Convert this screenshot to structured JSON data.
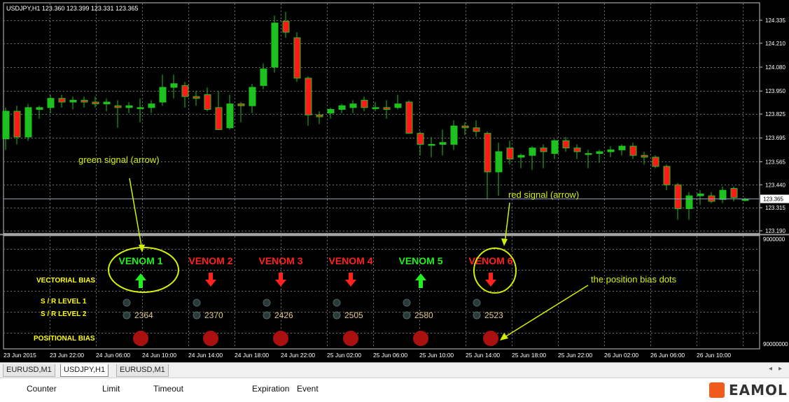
{
  "chart": {
    "symbol_info": "USDJPY,H1  123.360 123.399 123.331 123.365",
    "current_price": "123.365",
    "price_labels": [
      "124.335",
      "124.210",
      "124.080",
      "123.950",
      "123.825",
      "123.695",
      "123.565",
      "123.440",
      "123.315",
      "123.190"
    ],
    "indicator_labels": [
      "9000000",
      "90000000"
    ],
    "time_labels": [
      "23 Jun 2015",
      "23 Jun 22:00",
      "24 Jun 06:00",
      "24 Jun 10:00",
      "24 Jun 14:00",
      "24 Jun 18:00",
      "24 Jun 22:00",
      "25 Jun 02:00",
      "25 Jun 06:00",
      "25 Jun 10:00",
      "25 Jun 14:00",
      "25 Jun 18:00",
      "25 Jun 22:00",
      "26 Jun 02:00",
      "26 Jun 06:00",
      "26 Jun 10:00"
    ],
    "colors": {
      "bull": "#1ec21e",
      "bear": "#ff1a1a",
      "wick": "#1ec21e",
      "grid": "#707070",
      "annotation": "#d4f000",
      "venom_red": "#ff2020",
      "venom_green": "#22ee22",
      "row_label": "#ffff00",
      "dot": "#aa1010"
    }
  },
  "annotations": {
    "green_signal": "green signal (arrow)",
    "red_signal": "red signal (arrow)",
    "position_dots": "the position bias dots"
  },
  "panel": {
    "rows": [
      "VECTORIAL BIAS",
      "S / R LEVEL 1",
      "S / R LEVEL 2",
      "POSITIONAL BIAS"
    ],
    "venoms": [
      {
        "label": "VENOM 1",
        "direction": "up",
        "level2": "2364"
      },
      {
        "label": "VENOM 2",
        "direction": "down",
        "level2": "2370"
      },
      {
        "label": "VENOM 3",
        "direction": "down",
        "level2": "2426"
      },
      {
        "label": "VENOM 4",
        "direction": "down",
        "level2": "2505"
      },
      {
        "label": "VENOM 5",
        "direction": "up",
        "level2": "2580"
      },
      {
        "label": "VENOM 6",
        "direction": "down",
        "level2": "2523"
      }
    ]
  },
  "tabs": [
    "EURUSD,M1",
    "USDJPY,H1",
    "EURUSD,M1"
  ],
  "active_tab": 1,
  "terminal_columns": [
    "Counter",
    "Limit",
    "Timeout",
    "Expiration",
    "Event"
  ],
  "logo": "EAMOL",
  "candles": [
    {
      "o": 123.69,
      "h": 123.86,
      "l": 123.63,
      "c": 123.84
    },
    {
      "o": 123.84,
      "h": 123.87,
      "l": 123.66,
      "c": 123.7
    },
    {
      "o": 123.7,
      "h": 123.88,
      "l": 123.68,
      "c": 123.86
    },
    {
      "o": 123.85,
      "h": 123.87,
      "l": 123.8,
      "c": 123.86
    },
    {
      "o": 123.86,
      "h": 123.93,
      "l": 123.83,
      "c": 123.91
    },
    {
      "o": 123.91,
      "h": 123.93,
      "l": 123.86,
      "c": 123.89
    },
    {
      "o": 123.89,
      "h": 123.92,
      "l": 123.85,
      "c": 123.9
    },
    {
      "o": 123.9,
      "h": 123.92,
      "l": 123.86,
      "c": 123.89
    },
    {
      "o": 123.89,
      "h": 123.92,
      "l": 123.86,
      "c": 123.88
    },
    {
      "o": 123.88,
      "h": 123.91,
      "l": 123.84,
      "c": 123.89
    },
    {
      "o": 123.87,
      "h": 123.9,
      "l": 123.75,
      "c": 123.86
    },
    {
      "o": 123.86,
      "h": 123.89,
      "l": 123.83,
      "c": 123.87
    },
    {
      "o": 123.86,
      "h": 123.91,
      "l": 123.78,
      "c": 123.86
    },
    {
      "o": 123.86,
      "h": 123.9,
      "l": 123.83,
      "c": 123.88
    },
    {
      "o": 123.89,
      "h": 124.04,
      "l": 123.87,
      "c": 123.97
    },
    {
      "o": 123.97,
      "h": 124.04,
      "l": 123.91,
      "c": 123.99
    },
    {
      "o": 123.98,
      "h": 124.0,
      "l": 123.86,
      "c": 123.92
    },
    {
      "o": 123.92,
      "h": 123.95,
      "l": 123.87,
      "c": 123.91
    },
    {
      "o": 123.93,
      "h": 123.97,
      "l": 123.84,
      "c": 123.85
    },
    {
      "o": 123.86,
      "h": 123.95,
      "l": 123.77,
      "c": 123.74
    },
    {
      "o": 123.75,
      "h": 123.93,
      "l": 123.74,
      "c": 123.88
    },
    {
      "o": 123.88,
      "h": 123.89,
      "l": 123.78,
      "c": 123.87
    },
    {
      "o": 123.87,
      "h": 123.99,
      "l": 123.83,
      "c": 123.97
    },
    {
      "o": 123.98,
      "h": 124.1,
      "l": 123.96,
      "c": 124.07
    },
    {
      "o": 124.08,
      "h": 124.36,
      "l": 124.05,
      "c": 124.32
    },
    {
      "o": 124.33,
      "h": 124.38,
      "l": 124.24,
      "c": 124.27
    },
    {
      "o": 124.24,
      "h": 124.27,
      "l": 124.0,
      "c": 124.02
    },
    {
      "o": 124.02,
      "h": 124.03,
      "l": 123.76,
      "c": 123.82
    },
    {
      "o": 123.82,
      "h": 123.84,
      "l": 123.77,
      "c": 123.81
    },
    {
      "o": 123.83,
      "h": 123.86,
      "l": 123.8,
      "c": 123.85
    },
    {
      "o": 123.85,
      "h": 123.88,
      "l": 123.83,
      "c": 123.87
    },
    {
      "o": 123.86,
      "h": 123.9,
      "l": 123.83,
      "c": 123.88
    },
    {
      "o": 123.9,
      "h": 123.92,
      "l": 123.84,
      "c": 123.86
    },
    {
      "o": 123.86,
      "h": 123.89,
      "l": 123.84,
      "c": 123.86
    },
    {
      "o": 123.86,
      "h": 123.9,
      "l": 123.8,
      "c": 123.85
    },
    {
      "o": 123.86,
      "h": 123.93,
      "l": 123.85,
      "c": 123.88
    },
    {
      "o": 123.89,
      "h": 123.9,
      "l": 123.72,
      "c": 123.72
    },
    {
      "o": 123.72,
      "h": 123.73,
      "l": 123.6,
      "c": 123.66
    },
    {
      "o": 123.66,
      "h": 123.7,
      "l": 123.59,
      "c": 123.66
    },
    {
      "o": 123.66,
      "h": 123.74,
      "l": 123.6,
      "c": 123.67
    },
    {
      "o": 123.66,
      "h": 123.79,
      "l": 123.63,
      "c": 123.76
    },
    {
      "o": 123.76,
      "h": 123.78,
      "l": 123.71,
      "c": 123.75
    },
    {
      "o": 123.75,
      "h": 123.79,
      "l": 123.7,
      "c": 123.73
    },
    {
      "o": 123.72,
      "h": 123.73,
      "l": 123.36,
      "c": 123.51
    },
    {
      "o": 123.51,
      "h": 123.67,
      "l": 123.38,
      "c": 123.62
    },
    {
      "o": 123.64,
      "h": 123.68,
      "l": 123.55,
      "c": 123.58
    },
    {
      "o": 123.59,
      "h": 123.61,
      "l": 123.53,
      "c": 123.6
    },
    {
      "o": 123.6,
      "h": 123.65,
      "l": 123.52,
      "c": 123.64
    },
    {
      "o": 123.64,
      "h": 123.66,
      "l": 123.53,
      "c": 123.62
    },
    {
      "o": 123.61,
      "h": 123.69,
      "l": 123.58,
      "c": 123.68
    },
    {
      "o": 123.68,
      "h": 123.7,
      "l": 123.62,
      "c": 123.64
    },
    {
      "o": 123.64,
      "h": 123.66,
      "l": 123.58,
      "c": 123.62
    },
    {
      "o": 123.61,
      "h": 123.63,
      "l": 123.53,
      "c": 123.61
    },
    {
      "o": 123.61,
      "h": 123.63,
      "l": 123.56,
      "c": 123.62
    },
    {
      "o": 123.62,
      "h": 123.65,
      "l": 123.59,
      "c": 123.63
    },
    {
      "o": 123.63,
      "h": 123.66,
      "l": 123.6,
      "c": 123.65
    },
    {
      "o": 123.65,
      "h": 123.67,
      "l": 123.58,
      "c": 123.6
    },
    {
      "o": 123.6,
      "h": 123.62,
      "l": 123.55,
      "c": 123.59
    },
    {
      "o": 123.59,
      "h": 123.6,
      "l": 123.53,
      "c": 123.54
    },
    {
      "o": 123.54,
      "h": 123.55,
      "l": 123.41,
      "c": 123.44
    },
    {
      "o": 123.44,
      "h": 123.45,
      "l": 123.25,
      "c": 123.31
    },
    {
      "o": 123.31,
      "h": 123.4,
      "l": 123.25,
      "c": 123.38
    },
    {
      "o": 123.38,
      "h": 123.41,
      "l": 123.33,
      "c": 123.39
    },
    {
      "o": 123.38,
      "h": 123.4,
      "l": 123.34,
      "c": 123.35
    },
    {
      "o": 123.36,
      "h": 123.43,
      "l": 123.34,
      "c": 123.41
    },
    {
      "o": 123.42,
      "h": 123.43,
      "l": 123.35,
      "c": 123.37
    },
    {
      "o": 123.36,
      "h": 123.37,
      "l": 123.35,
      "c": 123.36
    }
  ]
}
